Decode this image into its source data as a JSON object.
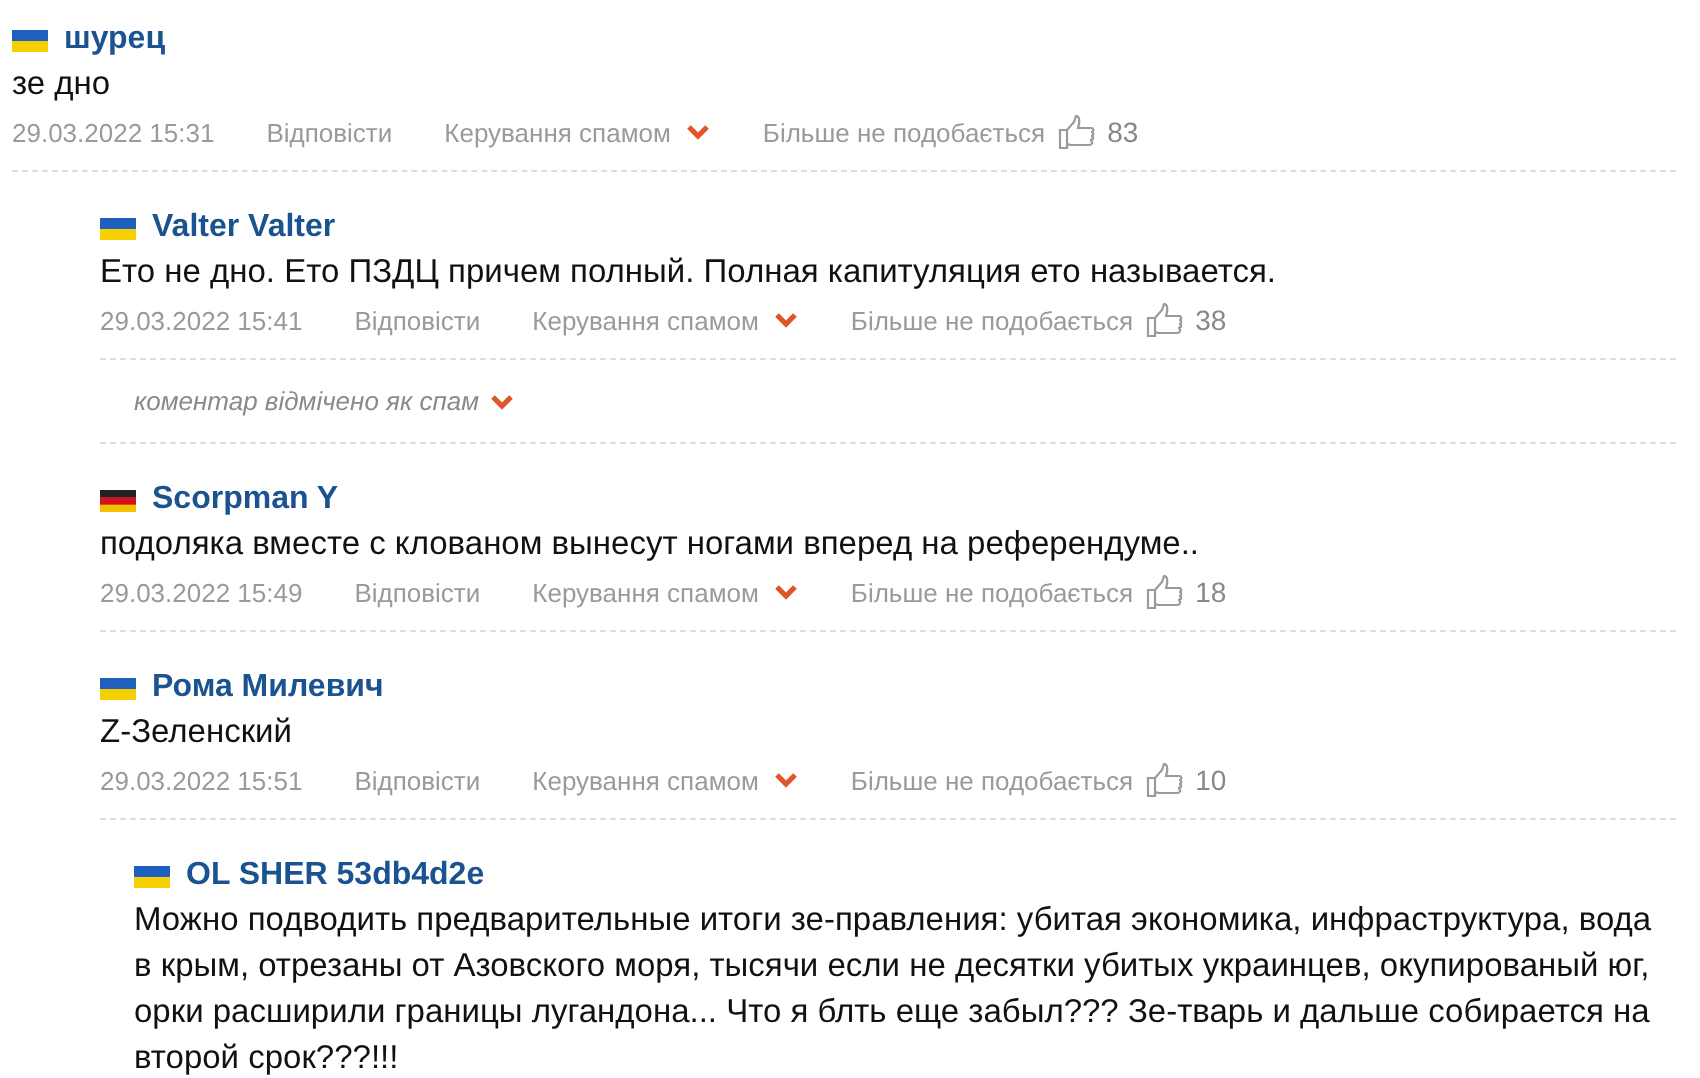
{
  "comments": [
    {
      "kind": "comment",
      "flag": {
        "kind": "ukraine"
      },
      "author": "шурец",
      "text": "зе дно",
      "date": "29.03.2022 15:31",
      "reply": "Відповісти",
      "spam": "Керування спамом",
      "unlike": "Більше не подобається",
      "likes": "83",
      "children": [
        {
          "kind": "comment",
          "flag": {
            "kind": "ukraine"
          },
          "author": "Valter Valter",
          "text": "Ето не дно. Ето ПЗДЦ причем полный. Полная капитуляция ето называется.",
          "date": "29.03.2022 15:41",
          "reply": "Відповісти",
          "spam": "Керування спамом",
          "unlike": "Більше не подобається",
          "likes": "38",
          "children": [
            {
              "kind": "spam_note",
              "text": "коментар відмічено як спам"
            }
          ]
        },
        {
          "kind": "comment",
          "flag": {
            "kind": "germany"
          },
          "author": "Scorpman Y",
          "text": "подоляка вместе с клованом вынесут ногами вперед на референдуме..",
          "date": "29.03.2022 15:49",
          "reply": "Відповісти",
          "spam": "Керування спамом",
          "unlike": "Більше не подобається",
          "likes": "18"
        },
        {
          "kind": "comment",
          "flag": {
            "kind": "ukraine"
          },
          "author": "Рома Милевич",
          "text": "Z-Зеленский",
          "date": "29.03.2022 15:51",
          "reply": "Відповісти",
          "spam": "Керування спамом",
          "unlike": "Більше не подобається",
          "likes": "10",
          "children": [
            {
              "kind": "comment",
              "flag": {
                "kind": "ukraine"
              },
              "author": "OL SHER 53db4d2e",
              "text": "Можно подводить предварительные итоги зе-правления: убитая экономика, инфраструктура, вода в крым, отрезаны от Азовского моря, тысячи если не десятки убитых украинцев, окупированый юг, орки расширили границы лугандона... Что я блть еще забыл??? Зе-тварь и дальше собирается на второй срок???!!!"
            }
          ]
        }
      ]
    }
  ]
}
